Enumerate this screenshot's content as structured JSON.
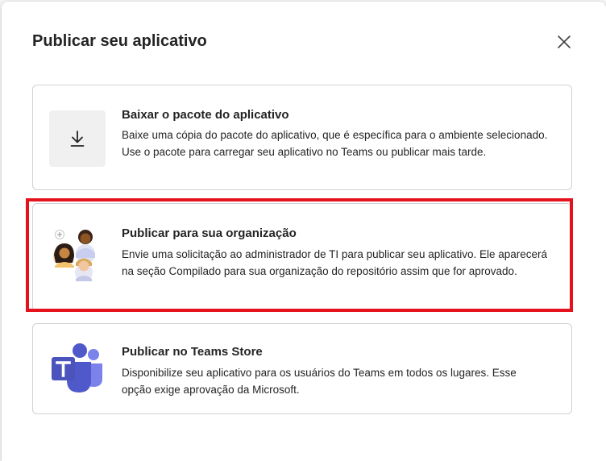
{
  "dialog": {
    "title": "Publicar seu aplicativo",
    "close_icon": "close-icon"
  },
  "options": [
    {
      "icon": "download-icon",
      "title": "Baixar o pacote do aplicativo",
      "description": "Baixe uma cópia do pacote do aplicativo, que é específica para o ambiente selecionado. Use o pacote para carregar seu aplicativo no Teams ou publicar mais tarde."
    },
    {
      "icon": "people-group-icon",
      "title": "Publicar para sua organização",
      "description": "Envie uma solicitação ao administrador de TI para publicar seu aplicativo. Ele aparecerá na seção Compilado para sua organização do repositório assim que for aprovado.",
      "highlighted": true
    },
    {
      "icon": "teams-logo-icon",
      "title": "Publicar no Teams Store",
      "description": "Disponibilize seu aplicativo para os usuários do Teams em todos os lugares. Esse opção exige aprovação da Microsoft."
    }
  ],
  "colors": {
    "highlight": "#e4121c",
    "teams_purple": "#5b5fc7"
  }
}
